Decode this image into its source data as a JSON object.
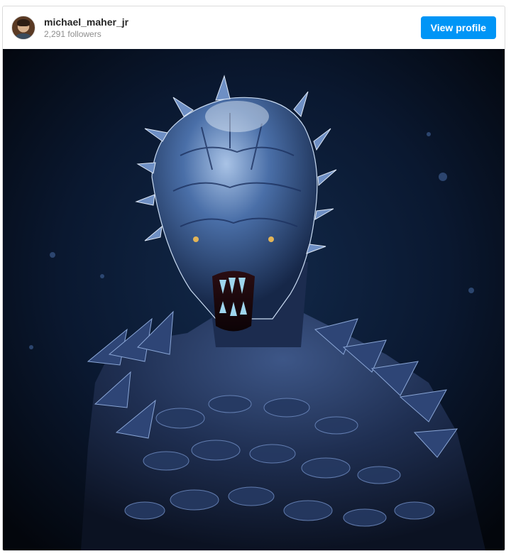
{
  "post": {
    "username": "michael_maher_jr",
    "followers": "2,291 followers",
    "view_profile_label": "View profile",
    "media_subject": "creature-portrait"
  },
  "colors": {
    "accent": "#0095f6",
    "username": "#262626",
    "secondary_text": "#8e8e8e",
    "border": "#dbdbdb",
    "media_background": "#05080f"
  }
}
